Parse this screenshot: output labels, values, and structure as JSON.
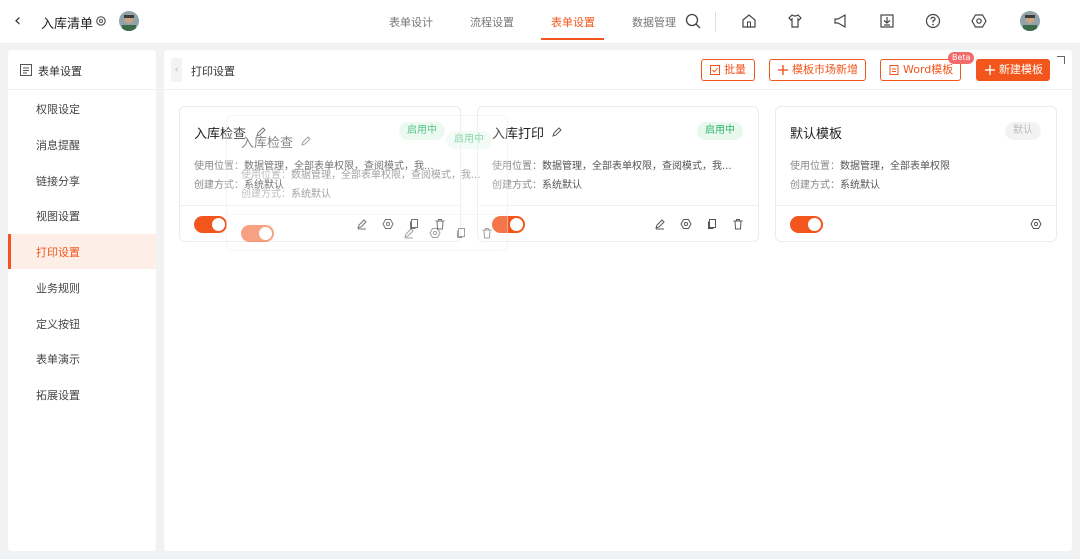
{
  "header": {
    "title": "入库清单",
    "tabs": [
      {
        "label": "表单设计",
        "active": false
      },
      {
        "label": "流程设置",
        "active": false
      },
      {
        "label": "表单设置",
        "active": true
      },
      {
        "label": "数据管理",
        "active": false
      }
    ],
    "icons": [
      "search-icon",
      "home-icon",
      "shirt-icon",
      "megaphone-icon",
      "download-icon",
      "help-icon",
      "settings-icon"
    ],
    "accent_color": "#f2561d"
  },
  "sidebar": {
    "heading": "表单设置",
    "items": [
      {
        "label": "权限设定",
        "active": false
      },
      {
        "label": "消息提醒",
        "active": false
      },
      {
        "label": "链接分享",
        "active": false
      },
      {
        "label": "视图设置",
        "active": false
      },
      {
        "label": "打印设置",
        "active": true
      },
      {
        "label": "业务规则",
        "active": false
      },
      {
        "label": "定义按钮",
        "active": false
      },
      {
        "label": "表单演示",
        "active": false
      },
      {
        "label": "拓展设置",
        "active": false
      }
    ]
  },
  "main": {
    "title": "打印设置",
    "buttons": {
      "batch": "批量",
      "market": "模板市场新增",
      "word": "Word模板",
      "word_badge": "Beta",
      "new": "新建模板"
    },
    "meta_labels": {
      "usage": "使用位置：",
      "created": "创建方式："
    },
    "cards": [
      {
        "title": "入库检查",
        "status": "启用中",
        "usage": "数据管理，全部表单权限，查阅模式，我...",
        "created": "系统默认",
        "enabled": true
      },
      {
        "title": "入库打印",
        "status": "启用中",
        "usage": "数据管理，全部表单权限，查阅模式，我...",
        "created": "系统默认",
        "enabled": true
      },
      {
        "title": "默认模板",
        "status": "默认",
        "usage": "数据管理，全部表单权限",
        "created": "系统默认",
        "enabled": true
      }
    ],
    "ghost_card": {
      "title": "入库检查",
      "status": "启用中",
      "usage": "数据管理，全部表单权限，查阅模式，我...",
      "created": "系统默认"
    }
  }
}
